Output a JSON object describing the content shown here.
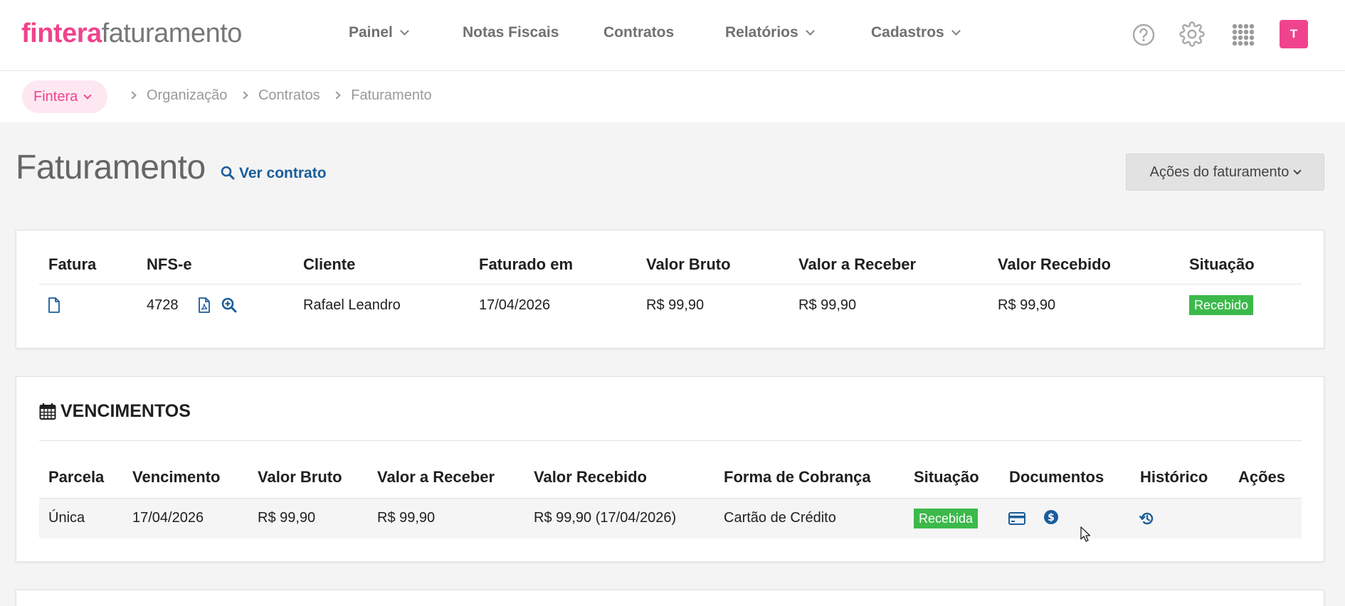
{
  "logo": {
    "brand": "fintera",
    "product": "faturamento"
  },
  "nav": [
    {
      "label": "Painel",
      "has_dropdown": true
    },
    {
      "label": "Notas Fiscais",
      "has_dropdown": false
    },
    {
      "label": "Contratos",
      "has_dropdown": false
    },
    {
      "label": "Relatórios",
      "has_dropdown": true
    },
    {
      "label": "Cadastros",
      "has_dropdown": true
    }
  ],
  "top_icons": [
    "help-icon",
    "gear-icon",
    "apps-grid-icon"
  ],
  "user": {
    "avatar_initial": "T"
  },
  "breadcrumb": {
    "org": "Fintera",
    "items": [
      "Organização",
      "Contratos",
      "Faturamento"
    ]
  },
  "page": {
    "title": "Faturamento",
    "ver_contrato": "Ver contrato",
    "acoes": "Ações do faturamento"
  },
  "fatura_table": {
    "headers": [
      "Fatura",
      "NFS-e",
      "Cliente",
      "Faturado em",
      "Valor Bruto",
      "Valor a Receber",
      "Valor Recebido",
      "Situação"
    ],
    "row": {
      "nfse": "4728",
      "cliente": "Rafael Leandro",
      "faturado_em": "17/04/2026",
      "valor_bruto": "R$ 99,90",
      "valor_a_receber": "R$ 99,90",
      "valor_recebido": "R$ 99,90",
      "situacao": "Recebido"
    }
  },
  "vencimentos": {
    "title": "VENCIMENTOS",
    "headers": [
      "Parcela",
      "Vencimento",
      "Valor Bruto",
      "Valor a Receber",
      "Valor Recebido",
      "Forma de Cobrança",
      "Situação",
      "Documentos",
      "Histórico",
      "Ações"
    ],
    "row": {
      "parcela": "Única",
      "vencimento": "17/04/2026",
      "valor_bruto": "R$ 99,90",
      "valor_a_receber": "R$ 99,90",
      "valor_recebido": "R$ 99,90 (17/04/2026)",
      "forma_cobranca": "Cartão de Crédito",
      "situacao": "Recebida"
    }
  },
  "colors": {
    "brand": "#f0438d",
    "link": "#1a5d9a",
    "success": "#3cb94b"
  }
}
